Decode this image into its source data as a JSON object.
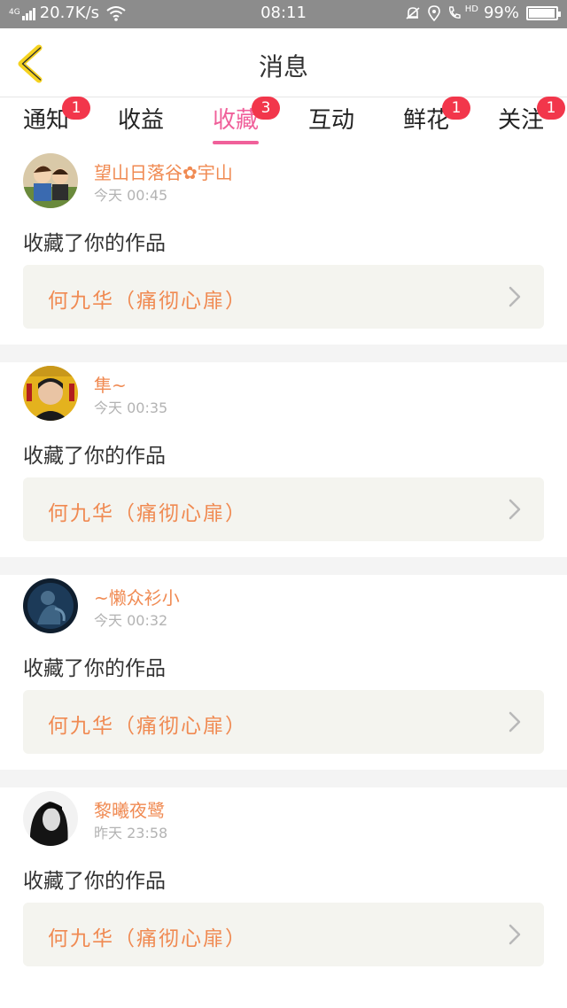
{
  "status_bar": {
    "network_type": "4G",
    "speed": "20.7K/s",
    "time": "08:11",
    "hd": "HD",
    "battery": "99%"
  },
  "header": {
    "title": "消息"
  },
  "tabs": [
    {
      "label": "通知",
      "badge": "1",
      "active": false
    },
    {
      "label": "收益",
      "badge": "",
      "active": false
    },
    {
      "label": "收藏",
      "badge": "3",
      "active": true
    },
    {
      "label": "互动",
      "badge": "",
      "active": false
    },
    {
      "label": "鲜花",
      "badge": "1",
      "active": false
    },
    {
      "label": "关注",
      "badge": "1",
      "active": false
    }
  ],
  "notifications": [
    {
      "username": "望山日落谷✿宇山",
      "time": "今天 00:45",
      "action": "收藏了你的作品",
      "work": "何九华（痛彻心扉）"
    },
    {
      "username": "隼~",
      "time": "今天 00:35",
      "action": "收藏了你的作品",
      "work": "何九华（痛彻心扉）"
    },
    {
      "username": "~懒众衫小",
      "time": "今天 00:32",
      "action": "收藏了你的作品",
      "work": "何九华（痛彻心扉）"
    },
    {
      "username": "黎曦夜鹭",
      "time": "昨天 23:58",
      "action": "收藏了你的作品",
      "work": "何九华（痛彻心扉）"
    }
  ],
  "colors": {
    "accent_pink": "#f0609a",
    "badge_red": "#f2364b",
    "username_orange": "#f08a52",
    "status_bar_gray": "#8c8c8c",
    "back_arrow_yellow": "#f5d21f"
  },
  "icons": {
    "back": "chevron-left-icon",
    "arrow": "chevron-right-icon",
    "wifi": "wifi-icon",
    "mute": "bell-off-icon",
    "location": "location-icon",
    "call": "phone-hd-icon"
  }
}
